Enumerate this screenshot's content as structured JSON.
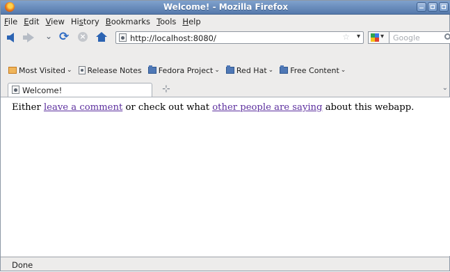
{
  "window": {
    "title": "Welcome! - Mozilla Firefox"
  },
  "menubar": {
    "items": [
      {
        "first": "F",
        "rest": "ile"
      },
      {
        "first": "E",
        "rest": "dit"
      },
      {
        "first": "V",
        "rest": "iew"
      },
      {
        "first": "Hi",
        "ul": "s",
        "rest2": "tory"
      },
      {
        "first": "B",
        "rest": "ookmarks"
      },
      {
        "first": "T",
        "rest": "ools"
      },
      {
        "first": "H",
        "rest": "elp"
      }
    ]
  },
  "navbar": {
    "url": "http://localhost:8080/",
    "search_placeholder": "Google"
  },
  "bookmarks": {
    "items": [
      {
        "label": "Most Visited",
        "icon": "most-visited-icon"
      },
      {
        "label": "Release Notes",
        "icon": "page-icon"
      },
      {
        "label": "Fedora Project",
        "icon": "folder-icon"
      },
      {
        "label": "Red Hat",
        "icon": "folder-icon"
      },
      {
        "label": "Free Content",
        "icon": "folder-icon"
      }
    ]
  },
  "tabs": [
    {
      "label": "Welcome!"
    }
  ],
  "content": {
    "before": "Either ",
    "link1": "leave a comment",
    "middle": " or check out what ",
    "link2": "other people are saying",
    "after": " about this webapp."
  },
  "status": {
    "text": "Done"
  }
}
